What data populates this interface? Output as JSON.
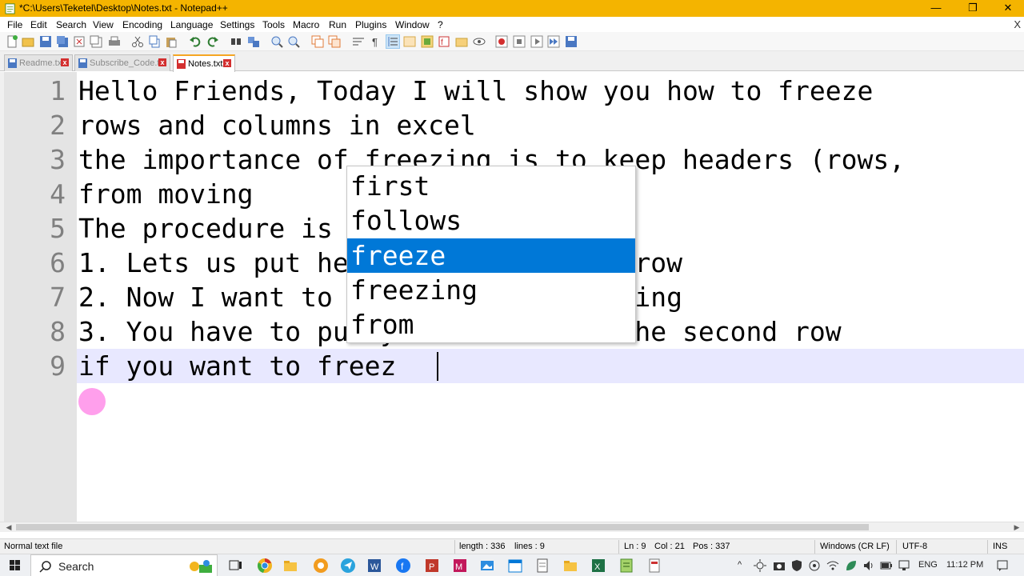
{
  "window": {
    "title": "*C:\\Users\\Teketel\\Desktop\\Notes.txt - Notepad++",
    "minimize_glyph": "—",
    "maximize_glyph": "❐",
    "close_glyph": "✕"
  },
  "menu": {
    "items": [
      "File",
      "Edit",
      "Search",
      "View",
      "Encoding",
      "Language",
      "Settings",
      "Tools",
      "Macro",
      "Run",
      "Plugins",
      "Window",
      "?"
    ],
    "close_glyph": "X"
  },
  "tabs": [
    {
      "label": "Readme.txt",
      "active": false
    },
    {
      "label": "Subscribe_Code.txt",
      "active": false
    },
    {
      "label": "Notes.txt",
      "active": true
    }
  ],
  "tab_close_glyph": "x",
  "editor": {
    "line_numbers": [
      "1",
      "2",
      "3",
      "4",
      "5",
      "6",
      "7",
      "8",
      "9"
    ],
    "lines": [
      "Hello Friends, Today I will show you how to freeze",
      "rows and columns in excel",
      "the importance of freezing is to keep headers (rows,",
      "from moving",
      "The procedure is as follows",
      "1. Lets us put header in the first row",
      "2. Now I want to freeze it from moving",
      "3. You have to put your cursor in the second row",
      "if you want to freez"
    ],
    "current_line": 9
  },
  "autocomplete": {
    "items": [
      "first",
      "follows",
      "freeze",
      "freezing",
      "from"
    ],
    "selected": "freeze"
  },
  "scrollbar": {
    "left_arrow": "◀",
    "right_arrow": "▶"
  },
  "status": {
    "doc_type": "Normal text file",
    "length": "length : 336",
    "lines": "lines : 9",
    "ln": "Ln : 9",
    "col": "Col : 21",
    "pos": "Pos : 337",
    "eol": "Windows (CR LF)",
    "encoding": "UTF-8",
    "mode": "INS"
  },
  "taskbar": {
    "search_label": "Search",
    "language": "ENG",
    "time": "11:12 PM",
    "tray_arrow": "^"
  },
  "colors": {
    "titlebar": "#f4b400",
    "selection": "#0078d7",
    "current_line": "#e8e8ff",
    "gutter": "#e4e4e4"
  }
}
